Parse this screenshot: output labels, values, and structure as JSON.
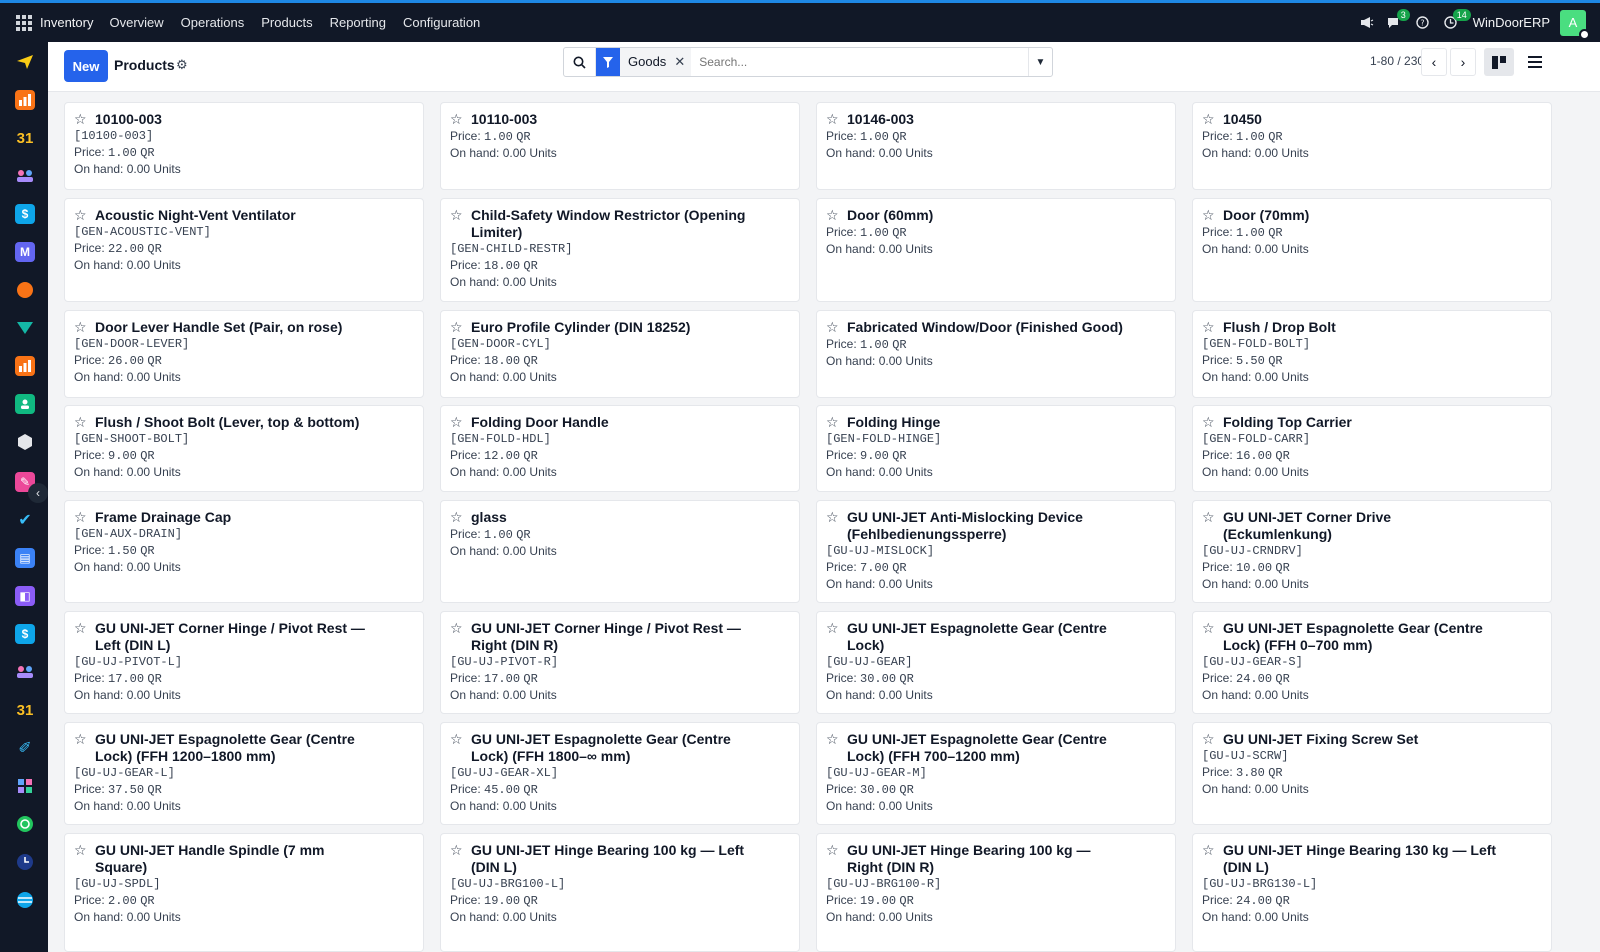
{
  "topbar": {
    "app_name": "Inventory",
    "menu": [
      "Overview",
      "Operations",
      "Products",
      "Reporting",
      "Configuration"
    ],
    "messages_count": "3",
    "activities_count": "14",
    "company": "WinDoorERP",
    "avatar_letter": "A"
  },
  "control": {
    "new_label": "New",
    "title": "Products",
    "facet": "Goods",
    "search_placeholder": "Search...",
    "pager": "1-80 / 230"
  },
  "products": [
    {
      "name": "10100-003",
      "ref": "[10100-003]",
      "price": "1.00",
      "on_hand": "0.00"
    },
    {
      "name": "10110-003",
      "ref": "",
      "price": "1.00",
      "on_hand": "0.00"
    },
    {
      "name": "10146-003",
      "ref": "",
      "price": "1.00",
      "on_hand": "0.00"
    },
    {
      "name": "10450",
      "ref": "",
      "price": "1.00",
      "on_hand": "0.00"
    },
    {
      "name": "Acoustic Night-Vent Ventilator",
      "ref": "[GEN-ACOUSTIC-VENT]",
      "price": "22.00",
      "on_hand": "0.00"
    },
    {
      "name": "Child-Safety Window Restrictor (Opening Limiter)",
      "ref": "[GEN-CHILD-RESTR]",
      "price": "18.00",
      "on_hand": "0.00"
    },
    {
      "name": "Door (60mm)",
      "ref": "",
      "price": "1.00",
      "on_hand": "0.00"
    },
    {
      "name": "Door (70mm)",
      "ref": "",
      "price": "1.00",
      "on_hand": "0.00"
    },
    {
      "name": "Door Lever Handle Set (Pair, on rose)",
      "ref": "[GEN-DOOR-LEVER]",
      "price": "26.00",
      "on_hand": "0.00"
    },
    {
      "name": "Euro Profile Cylinder (DIN 18252)",
      "ref": "[GEN-DOOR-CYL]",
      "price": "18.00",
      "on_hand": "0.00"
    },
    {
      "name": "Fabricated Window/Door (Finished Good)",
      "ref": "",
      "price": "1.00",
      "on_hand": "0.00"
    },
    {
      "name": "Flush / Drop Bolt",
      "ref": "[GEN-FOLD-BOLT]",
      "price": "5.50",
      "on_hand": "0.00"
    },
    {
      "name": "Flush / Shoot Bolt (Lever, top & bottom)",
      "ref": "[GEN-SHOOT-BOLT]",
      "price": "9.00",
      "on_hand": "0.00"
    },
    {
      "name": "Folding Door Handle",
      "ref": "[GEN-FOLD-HDL]",
      "price": "12.00",
      "on_hand": "0.00"
    },
    {
      "name": "Folding Hinge",
      "ref": "[GEN-FOLD-HINGE]",
      "price": "9.00",
      "on_hand": "0.00"
    },
    {
      "name": "Folding Top Carrier",
      "ref": "[GEN-FOLD-CARR]",
      "price": "16.00",
      "on_hand": "0.00"
    },
    {
      "name": "Frame Drainage Cap",
      "ref": "[GEN-AUX-DRAIN]",
      "price": "1.50",
      "on_hand": "0.00"
    },
    {
      "name": "glass",
      "ref": "",
      "price": "1.00",
      "on_hand": "0.00"
    },
    {
      "name": "GU UNI-JET Anti-Mislocking Device (Fehlbedienungssperre)",
      "ref": "[GU-UJ-MISLOCK]",
      "price": "7.00",
      "on_hand": "0.00"
    },
    {
      "name": "GU UNI-JET Corner Drive (Eckumlenkung)",
      "ref": "[GU-UJ-CRNDRV]",
      "price": "10.00",
      "on_hand": "0.00"
    },
    {
      "name": "GU UNI-JET Corner Hinge / Pivot Rest — Left (DIN L)",
      "ref": "[GU-UJ-PIVOT-L]",
      "price": "17.00",
      "on_hand": "0.00"
    },
    {
      "name": "GU UNI-JET Corner Hinge / Pivot Rest — Right (DIN R)",
      "ref": "[GU-UJ-PIVOT-R]",
      "price": "17.00",
      "on_hand": "0.00"
    },
    {
      "name": "GU UNI-JET Espagnolette Gear (Centre Lock)",
      "ref": "[GU-UJ-GEAR]",
      "price": "30.00",
      "on_hand": "0.00"
    },
    {
      "name": "GU UNI-JET Espagnolette Gear (Centre Lock) (FFH 0–700 mm)",
      "ref": "[GU-UJ-GEAR-S]",
      "price": "24.00",
      "on_hand": "0.00"
    },
    {
      "name": "GU UNI-JET Espagnolette Gear (Centre Lock) (FFH 1200–1800 mm)",
      "ref": "[GU-UJ-GEAR-L]",
      "price": "37.50",
      "on_hand": "0.00"
    },
    {
      "name": "GU UNI-JET Espagnolette Gear (Centre Lock) (FFH 1800–∞ mm)",
      "ref": "[GU-UJ-GEAR-XL]",
      "price": "45.00",
      "on_hand": "0.00"
    },
    {
      "name": "GU UNI-JET Espagnolette Gear (Centre Lock) (FFH 700–1200 mm)",
      "ref": "[GU-UJ-GEAR-M]",
      "price": "30.00",
      "on_hand": "0.00"
    },
    {
      "name": "GU UNI-JET Fixing Screw Set",
      "ref": "[GU-UJ-SCRW]",
      "price": "3.80",
      "on_hand": "0.00"
    },
    {
      "name": "GU UNI-JET Handle Spindle (7 mm Square)",
      "ref": "[GU-UJ-SPDL]",
      "price": "2.00",
      "on_hand": "0.00"
    },
    {
      "name": "GU UNI-JET Hinge Bearing 100 kg — Left (DIN L)",
      "ref": "[GU-UJ-BRG100-L]",
      "price": "19.00",
      "on_hand": "0.00"
    },
    {
      "name": "GU UNI-JET Hinge Bearing 100 kg — Right (DIN R)",
      "ref": "[GU-UJ-BRG100-R]",
      "price": "19.00",
      "on_hand": "0.00"
    },
    {
      "name": "GU UNI-JET Hinge Bearing 130 kg — Left (DIN L)",
      "ref": "[GU-UJ-BRG130-L]",
      "price": "24.00",
      "on_hand": "0.00"
    }
  ],
  "labels": {
    "price_prefix": "Price:",
    "currency": "QR",
    "on_hand_prefix": "On hand:",
    "unit": "Units"
  },
  "colors": {
    "accent": "#2563eb",
    "navbar": "#111827",
    "badge": "#16a34a"
  }
}
